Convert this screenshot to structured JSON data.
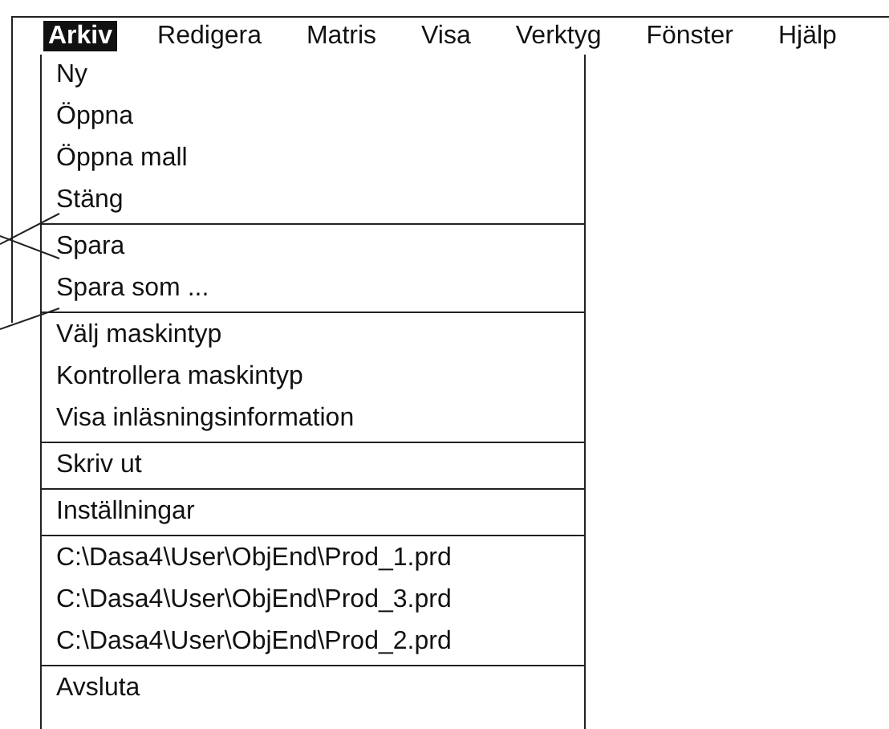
{
  "menu_bar": [
    {
      "label": "Arkiv",
      "selected": true
    },
    {
      "label": "Redigera",
      "selected": false
    },
    {
      "label": "Matris",
      "selected": false
    },
    {
      "label": "Visa",
      "selected": false
    },
    {
      "label": "Verktyg",
      "selected": false
    },
    {
      "label": "Fönster",
      "selected": false
    },
    {
      "label": "Hjälp",
      "selected": false
    }
  ],
  "dropdown": {
    "groups": [
      [
        "Ny",
        "Öppna",
        "Öppna mall",
        "Stäng"
      ],
      [
        "Spara",
        "Spara som ..."
      ],
      [
        "Välj maskintyp",
        "Kontrollera maskintyp",
        "Visa inläsningsinformation"
      ],
      [
        "Skriv ut"
      ],
      [
        "Inställningar"
      ],
      [
        "C:\\Dasa4\\User\\ObjEnd\\Prod_1.prd",
        "C:\\Dasa4\\User\\ObjEnd\\Prod_3.prd",
        "C:\\Dasa4\\User\\ObjEnd\\Prod_2.prd"
      ],
      [
        "Avsluta"
      ]
    ]
  }
}
